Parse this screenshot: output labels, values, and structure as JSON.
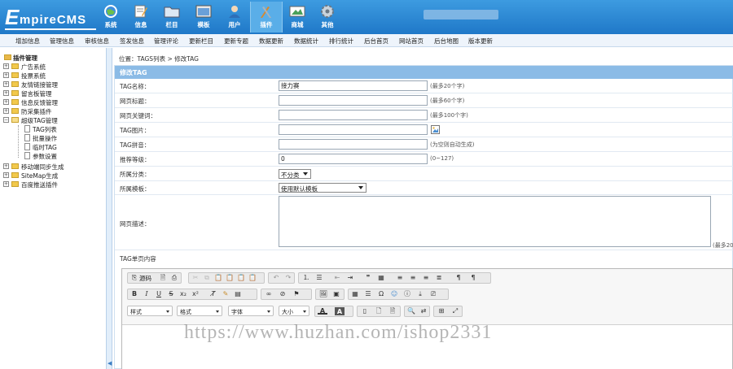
{
  "logo": {
    "big": "E",
    "rest": "mpireCMS"
  },
  "topnav": [
    {
      "label": "系统",
      "icon": "globe-icon"
    },
    {
      "label": "信息",
      "icon": "edit-icon"
    },
    {
      "label": "栏目",
      "icon": "folder-icon"
    },
    {
      "label": "模板",
      "icon": "template-icon"
    },
    {
      "label": "用户",
      "icon": "user-icon"
    },
    {
      "label": "插件",
      "icon": "tools-icon",
      "active": true
    },
    {
      "label": "商城",
      "icon": "shop-icon"
    },
    {
      "label": "其他",
      "icon": "gear-icon"
    }
  ],
  "submenu": [
    "增加信息",
    "管理信息",
    "审核信息",
    "签发信息",
    "管理评论",
    "更新栏目",
    "更新专题",
    "数据更新",
    "数据统计",
    "排行统计",
    "后台首页",
    "网站首页",
    "后台地图",
    "版本更新"
  ],
  "tree": {
    "root": "插件管理",
    "items": [
      "广告系统",
      "投票系统",
      "友情链接管理",
      "留言板管理",
      "信息反馈管理",
      "防采集插件",
      "超级TAG管理"
    ],
    "tag_children": [
      "TAG列表",
      "批量操作",
      "临时TAG",
      "参数设置"
    ],
    "after": [
      "移动端同步生成",
      "SiteMap生成",
      "百度推送插件"
    ]
  },
  "breadcrumb": "位置：TAGS列表 > 修改TAG",
  "form": {
    "title": "修改TAG",
    "tag_name_label": "TAG名称：",
    "tag_name_value": "接力赛",
    "tag_name_hint": "(最多20个字)",
    "page_title_label": "网页标题：",
    "page_title_hint": "(最多60个字)",
    "keywords_label": "网页关键词：",
    "keywords_hint": "(最多100个字)",
    "image_label": "TAG图片：",
    "pinyin_label": "TAG拼音：",
    "pinyin_hint": "(为空则自动生成)",
    "level_label": "推荐等级：",
    "level_value": "0",
    "level_hint": "(0~127)",
    "category_label": "所属分类：",
    "category_value": "不分类",
    "template_label": "所属模板：",
    "template_value": "使用默认模板",
    "desc_label": "网页描述：",
    "desc_hint": "(最多20",
    "content_label": "TAG单页内容"
  },
  "editor": {
    "source_label": "源码",
    "combos": [
      "样式",
      "格式",
      "字体",
      "大小"
    ]
  },
  "watermark": "https://www.huzhan.com/ishop2331"
}
